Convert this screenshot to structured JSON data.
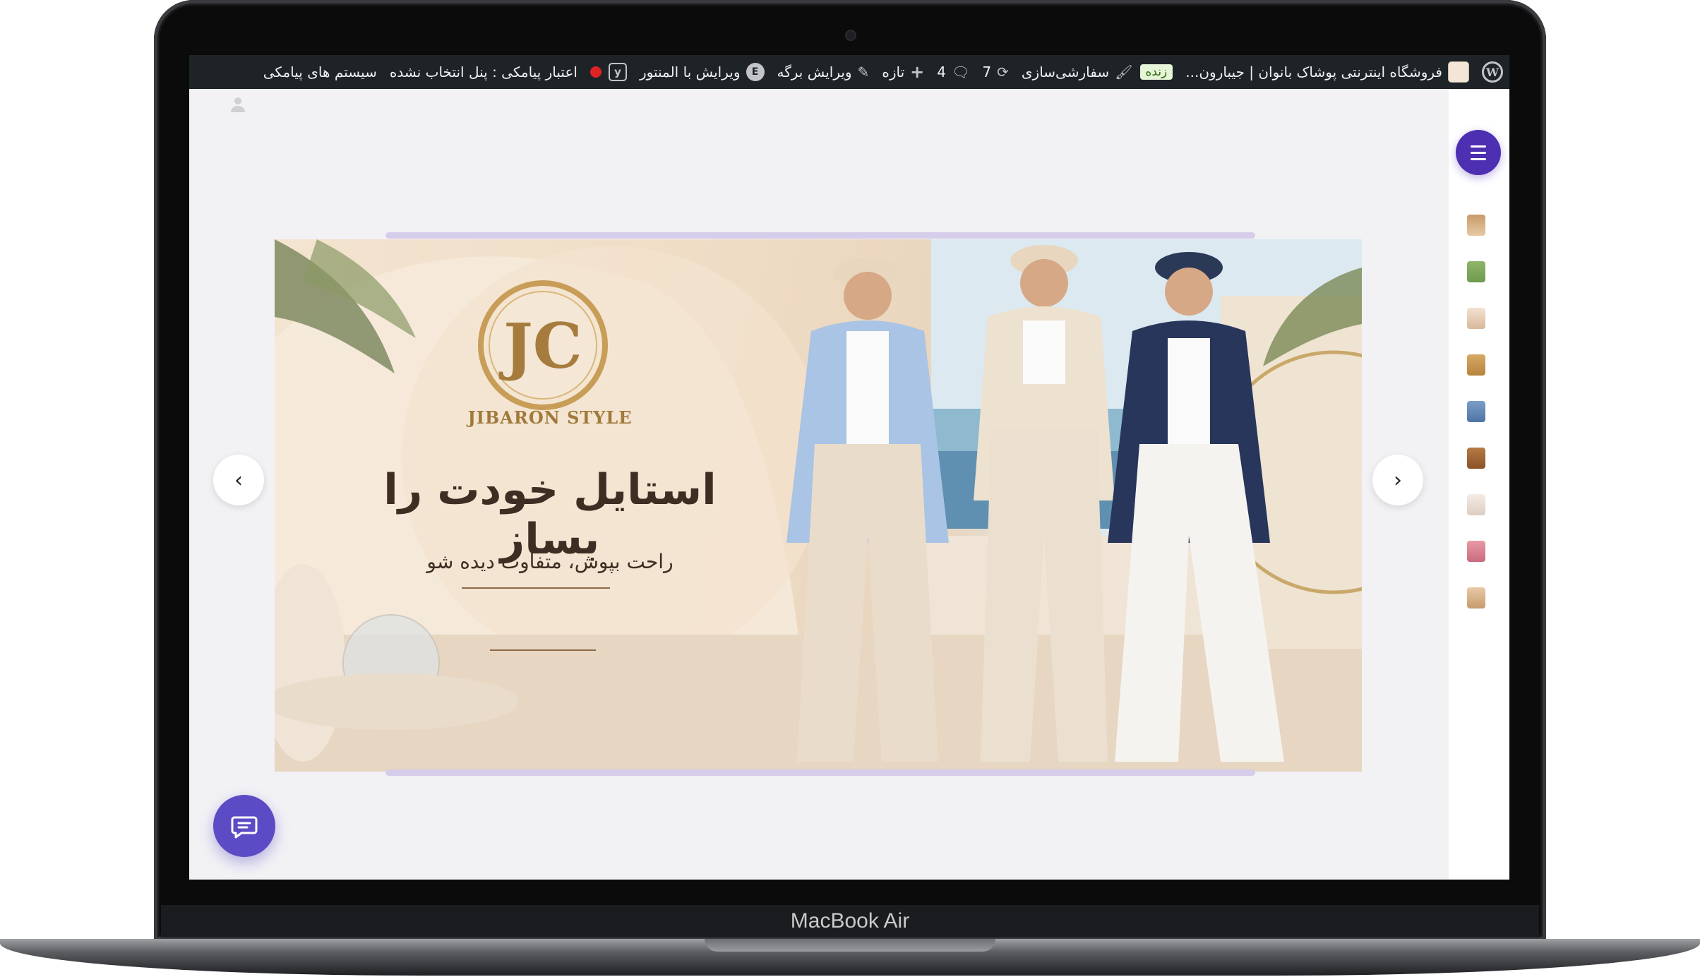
{
  "device": {
    "label": "MacBook Air"
  },
  "admin_bar": {
    "site_name": "فروشگاه اینترنتی پوشاک بانوان | جیبارون...",
    "live_badge": "زنده",
    "customize": "سفارشی‌سازی",
    "updates_count": "7",
    "comments_count": "4",
    "new_label": "تازه",
    "edit_page": "ویرایش برگه",
    "edit_elementor": "ویرایش با المنتور",
    "sms_credit": "اعتبار پیامکی : پنل انتخاب نشده",
    "sms_system": "سیستم های پیامکی"
  },
  "banner": {
    "brand_name": "JIBARON STYLE",
    "headline": "استایل خودت را بساز",
    "subline": "راحت بپوش، متفاوت دیده شو"
  },
  "colors": {
    "accent": "#4d2fb1",
    "chat": "#5b4bc4",
    "adminbar": "#1d2327",
    "slider_bar": "#d6cdeb"
  },
  "sidebar": {
    "thumbs": [
      "top",
      "dress",
      "shirt",
      "jacket",
      "jeans",
      "skirt",
      "blouse",
      "bag",
      "shoes"
    ]
  }
}
